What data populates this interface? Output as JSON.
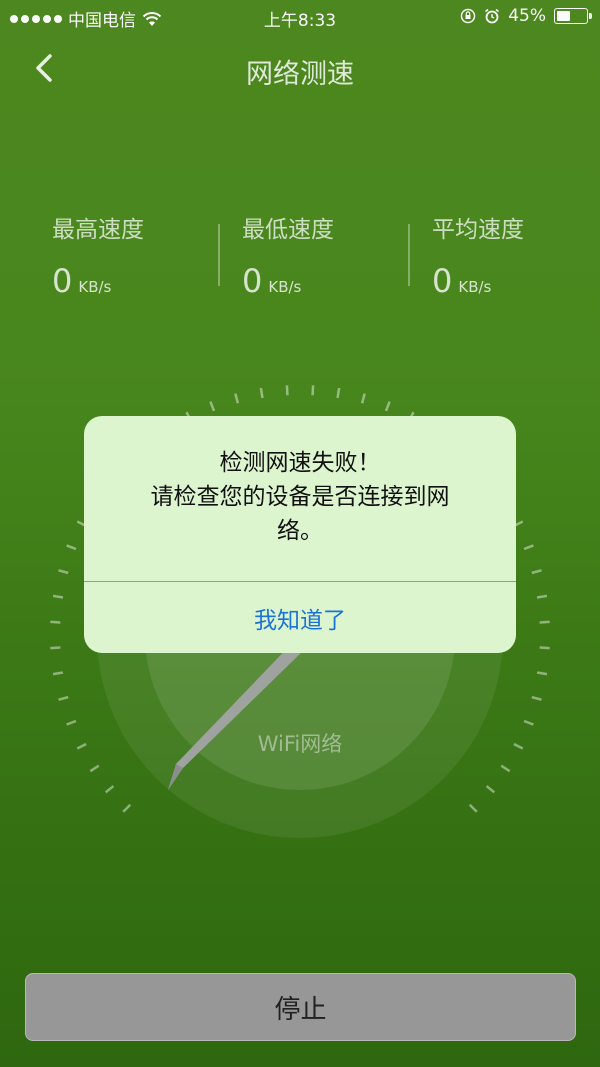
{
  "status_bar": {
    "carrier": "中国电信",
    "time": "上午8:33",
    "battery_percent": "45%",
    "battery_level": 0.45,
    "icons": [
      "signal-dots-icon",
      "wifi-icon",
      "orientation-lock-icon",
      "alarm-icon",
      "battery-icon"
    ]
  },
  "nav": {
    "title": "网络测速",
    "back_icon": "chevron-left-icon"
  },
  "stats": [
    {
      "label": "最高速度",
      "value": "0",
      "unit": "KB/s"
    },
    {
      "label": "最低速度",
      "value": "0",
      "unit": "KB/s"
    },
    {
      "label": "平均速度",
      "value": "0",
      "unit": "KB/s"
    }
  ],
  "gauge": {
    "label": "WiFi网络"
  },
  "stop_button": "停止",
  "alert": {
    "line1": "检测网速失败！",
    "line2": "请检查您的设备是否连接到网",
    "line3": "络。",
    "button": "我知道了"
  },
  "colors": {
    "background_top": "#4f8a20",
    "background_bottom": "#2f6a10",
    "alert_bg": "#ddf5cf",
    "alert_button": "#1a73d8",
    "stop_button_bg": "#9b9b9b"
  }
}
